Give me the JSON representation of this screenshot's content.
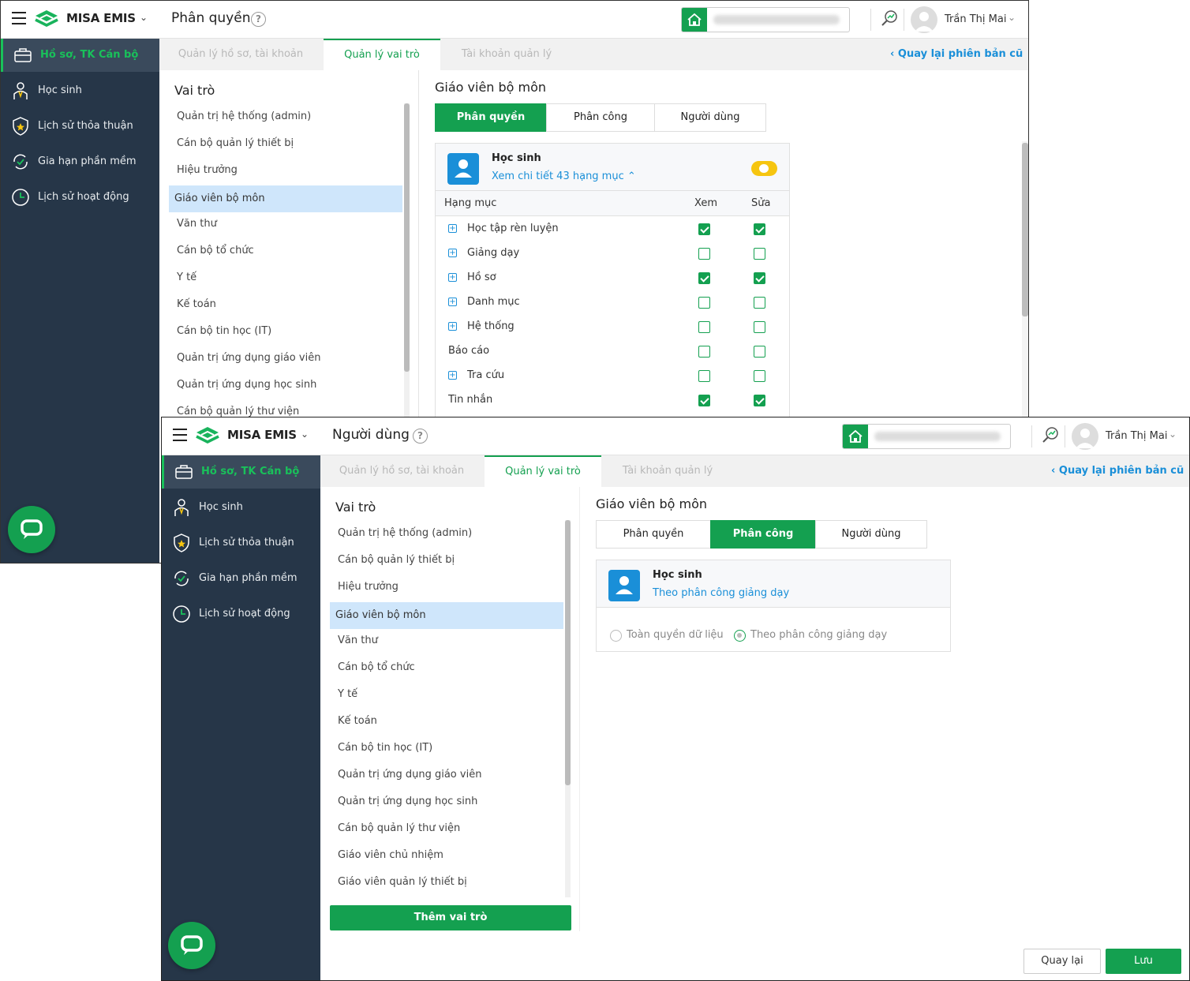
{
  "app": {
    "brand": "MISA EMIS",
    "user_name": "Trần Thị Mai"
  },
  "sidebar": {
    "items": [
      {
        "label": "Hồ sơ, TK Cán bộ",
        "icon": "briefcase-icon"
      },
      {
        "label": "Học sinh",
        "icon": "student-icon"
      },
      {
        "label": "Lịch sử thỏa thuận",
        "icon": "shield-star-icon"
      },
      {
        "label": "Gia hạn phần mềm",
        "icon": "renew-icon"
      },
      {
        "label": "Lịch sử hoạt động",
        "icon": "clock-icon"
      }
    ]
  },
  "tabs": [
    "Quản lý hồ sơ, tài khoản",
    "Quản lý vai trò",
    "Tài khoản quản lý"
  ],
  "back_link": "Quay lại phiên bản cũ",
  "roles_title": "Vai trò",
  "roles": [
    "Quản trị hệ thống (admin)",
    "Cán bộ quản lý thiết bị",
    "Hiệu trưởng",
    "Giáo viên bộ môn",
    "Văn thư",
    "Cán bộ tổ chức",
    "Y tế",
    "Kế toán",
    "Cán bộ tin học (IT)",
    "Quản trị ứng dụng giáo viên",
    "Quản trị ứng dụng học sinh",
    "Cán bộ quản lý thư viện",
    "Giáo viên chủ nhiệm",
    "Giáo viên quản lý thiết bị"
  ],
  "role_title": "Giáo viên bộ môn",
  "segments": [
    "Phân quyền",
    "Phân công",
    "Người dùng"
  ],
  "win1": {
    "page_title": "Phân quyền",
    "card": {
      "name": "Học sinh",
      "sub": "Xem chi tiết 43 hạng mục ⌃"
    },
    "table_headers": [
      "Hạng mục",
      "Xem",
      "Sửa"
    ],
    "rows": [
      {
        "name": "Học tập rèn luyện",
        "expandable": true,
        "view": true,
        "edit": true
      },
      {
        "name": "Giảng dạy",
        "expandable": true,
        "view": false,
        "edit": false
      },
      {
        "name": "Hồ sơ",
        "expandable": true,
        "view": true,
        "edit": true
      },
      {
        "name": "Danh mục",
        "expandable": true,
        "view": false,
        "edit": false
      },
      {
        "name": "Hệ thống",
        "expandable": true,
        "view": false,
        "edit": false
      },
      {
        "name": "Báo cáo",
        "expandable": false,
        "view": false,
        "edit": false
      },
      {
        "name": "Tra cứu",
        "expandable": true,
        "view": false,
        "edit": false
      },
      {
        "name": "Tin nhắn",
        "expandable": false,
        "view": true,
        "edit": true
      }
    ]
  },
  "win2": {
    "page_title": "Người dùng",
    "card": {
      "name": "Học sinh",
      "sub": "Theo phân công giảng dạy"
    },
    "options": [
      "Toàn quyền dữ liệu",
      "Theo phân công giảng dạy"
    ],
    "selected_option": "Theo phân công giảng dạy",
    "add_role_button": "Thêm vai trò",
    "back_button": "Quay lại",
    "save_button": "Lưu"
  },
  "colors": {
    "accent": "#14a050",
    "sidebar": "#263648",
    "link": "#1a8fd8",
    "toggle": "#f6c510"
  }
}
